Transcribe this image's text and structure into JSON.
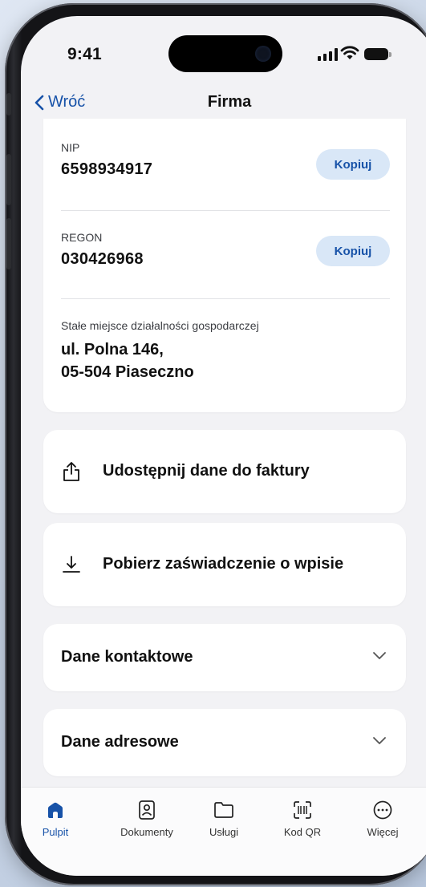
{
  "status_bar": {
    "time": "9:41"
  },
  "nav": {
    "back_label": "Wróć",
    "title": "Firma"
  },
  "company": {
    "nip": {
      "label": "NIP",
      "value": "6598934917",
      "copy_label": "Kopiuj"
    },
    "regon": {
      "label": "REGON",
      "value": "030426968",
      "copy_label": "Kopiuj"
    },
    "address": {
      "label": "Stałe miejsce działalności gospodarczej",
      "line1": "ul. Polna 146,",
      "line2": "05-504 Piaseczno"
    }
  },
  "actions": [
    {
      "label": "Udostępnij dane do faktury",
      "icon": "share-icon"
    },
    {
      "label": "Pobierz zaświadczenie o wpisie",
      "icon": "download-icon"
    }
  ],
  "sections": [
    {
      "label": "Dane kontaktowe",
      "icon": "chevron-down-icon"
    },
    {
      "label": "Dane adresowe",
      "icon": "chevron-down-icon"
    }
  ],
  "tabbar": {
    "items": [
      {
        "label": "Pulpit",
        "icon": "home-icon",
        "active": true
      },
      {
        "label": "Dokumenty",
        "icon": "id-card-icon",
        "active": false
      },
      {
        "label": "Usługi",
        "icon": "folder-icon",
        "active": false
      },
      {
        "label": "Kod QR",
        "icon": "qr-scan-icon",
        "active": false
      },
      {
        "label": "Więcej",
        "icon": "more-icon",
        "active": false
      }
    ]
  },
  "colors": {
    "accent": "#1752a8",
    "copy_bg": "#d9e7f7",
    "background": "#f2f2f5"
  }
}
